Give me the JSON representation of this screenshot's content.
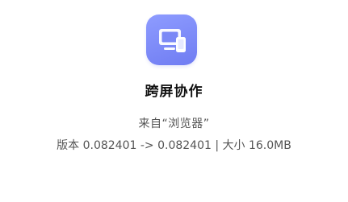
{
  "app": {
    "icon": "screen-collaboration-icon",
    "icon_color": "#7b88f6",
    "name": "跨屏协作"
  },
  "install_info": {
    "source_text": "来自“浏览器”",
    "version_line": "版本 0.082401 -> 0.082401 | 大小 16.0MB"
  }
}
